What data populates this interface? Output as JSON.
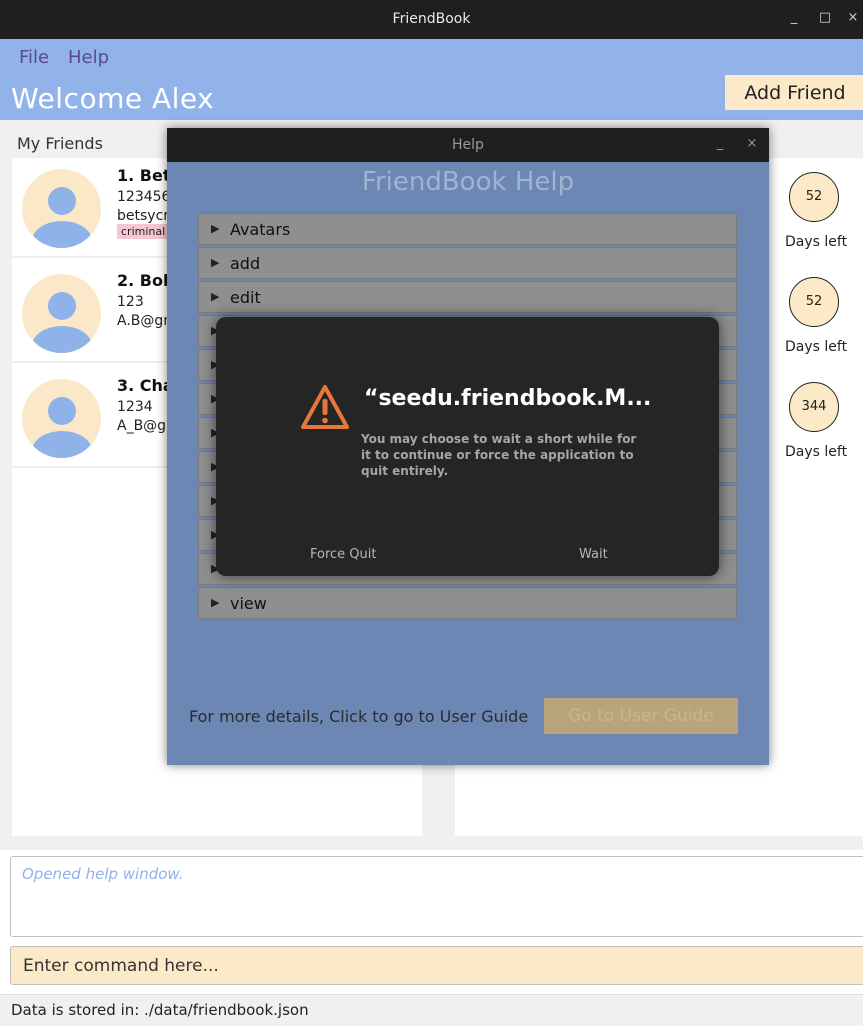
{
  "window": {
    "title": "FriendBook",
    "minimize": "_",
    "maximize": "□",
    "close": "×"
  },
  "menu": {
    "file": "File",
    "help": "Help"
  },
  "header": {
    "welcome": "Welcome Alex",
    "add_friend": "Add Friend"
  },
  "friends": {
    "title": "My Friends",
    "items": [
      {
        "name": "1. Bets",
        "phone": "1234567",
        "email": "betsycro",
        "tag": "criminal",
        "days": "52",
        "days_label": "Days left"
      },
      {
        "name": "2. Bob",
        "phone": "123",
        "email": "A.B@gm",
        "tag": "",
        "days": "52",
        "days_label": "Days left"
      },
      {
        "name": "3. Cha",
        "phone": "1234",
        "email": "A_B@gm",
        "tag": "",
        "days": "344",
        "days_label": "Days left"
      }
    ]
  },
  "result": {
    "text": "Opened help window."
  },
  "command": {
    "placeholder": "Enter command here..."
  },
  "status": {
    "text": "Data is stored in: ./data/friendbook.json"
  },
  "help_window": {
    "title": "Help",
    "minimize": "_",
    "close": "×",
    "heading": "FriendBook Help",
    "sections": [
      "Avatars",
      "add",
      "edit",
      "",
      "",
      "",
      "",
      "",
      "",
      "",
      "",
      "view"
    ],
    "footer": "For more details, Click to go to User Guide",
    "guide_button": "Go to User Guide"
  },
  "dialog": {
    "title": "“seedu.friendbook.M...",
    "message": "You may choose to wait a short while for it to continue or force the application to quit entirely.",
    "force_quit": "Force Quit",
    "wait": "Wait",
    "icon": "warning-icon",
    "icon_color": "#e8763a"
  }
}
